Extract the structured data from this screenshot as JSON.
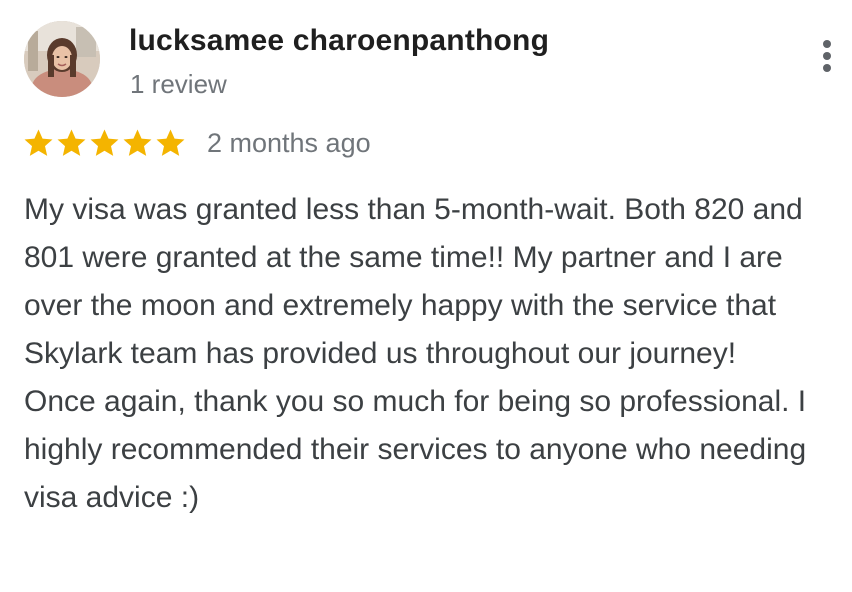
{
  "review": {
    "author_name": "lucksamee charoenpanthong",
    "review_count": "1 review",
    "rating": 5,
    "rating_max": 5,
    "date": "2 months ago",
    "text": "My visa was granted less than 5-month-wait. Both 820 and 801 were granted at the same time!! My partner and I are over the moon and extremely happy with the service that Skylark team has provided us throughout our journey! Once again, thank you so much for being so professional. I highly recommended their services to anyone who needing visa advice :)"
  },
  "icons": {
    "star": "star-icon",
    "more": "more-vert-icon"
  },
  "colors": {
    "star": "#F4B400",
    "name": "#1F1F1F",
    "meta": "#70757A",
    "body": "#3C4043"
  }
}
